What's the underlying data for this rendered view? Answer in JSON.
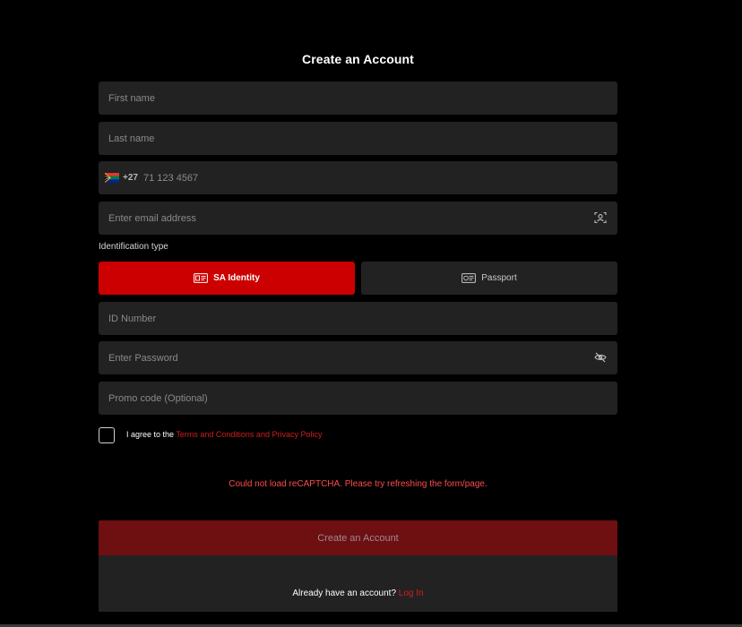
{
  "form": {
    "title": "Create an Account",
    "first_name_placeholder": "First name",
    "last_name_placeholder": "Last name",
    "phone": {
      "country_code": "+27",
      "placeholder": "71 123 4567",
      "flag_icon": "south-africa-flag"
    },
    "email_placeholder": "Enter email address",
    "email_icon": "user-scan-icon",
    "identification_label": "Identification type",
    "id_options": [
      {
        "label": "SA Identity",
        "icon": "id-card-icon",
        "selected": true
      },
      {
        "label": "Passport",
        "icon": "passport-icon",
        "selected": false
      }
    ],
    "id_number_placeholder": "ID Number",
    "password_placeholder": "Enter Password",
    "password_icon": "eye-off-icon",
    "promo_placeholder": "Promo code (Optional)",
    "agree_prefix": "I agree to the ",
    "agree_link": "Terms and Conditions and Privacy Policy",
    "recaptcha_error": "Could not load reCAPTCHA. Please try refreshing the form/page.",
    "submit_label": "Create an Account",
    "login_prompt": "Already have an account? ",
    "login_link": "Log In"
  },
  "colors": {
    "background": "#000000",
    "field": "#222222",
    "accent": "#cc0000",
    "submit_disabled": "#6e0f12",
    "error": "#ff4a4a",
    "link": "#d11f1f"
  }
}
